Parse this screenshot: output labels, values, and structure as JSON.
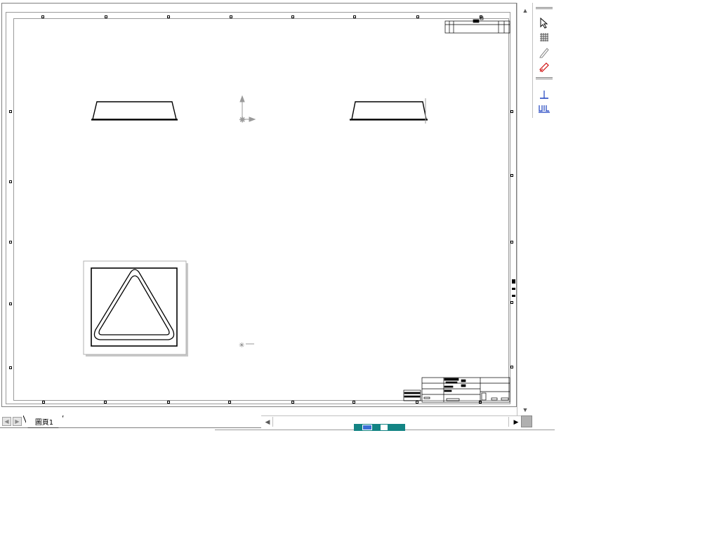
{
  "app": {
    "sheet_tab_label": "圖頁1"
  },
  "icons": {
    "palette": [
      "select-arrow-icon",
      "grid-icon",
      "sketch-pencil-icon",
      "smart-dimension-icon",
      "datum-icon",
      "surface-finish-icon"
    ],
    "scroll": [
      "scroll-up-icon",
      "scroll-down-icon",
      "scroll-left-icon",
      "scroll-right-icon"
    ],
    "tab_nav": [
      "tab-prev-icon",
      "tab-next-icon"
    ]
  },
  "colors": {
    "drawing_line": "#000000",
    "sheet_border": "#9a9a9a",
    "dimension_red": "#d01010",
    "datum_blue": "#1a3fbf",
    "taskbar": "#138484"
  }
}
